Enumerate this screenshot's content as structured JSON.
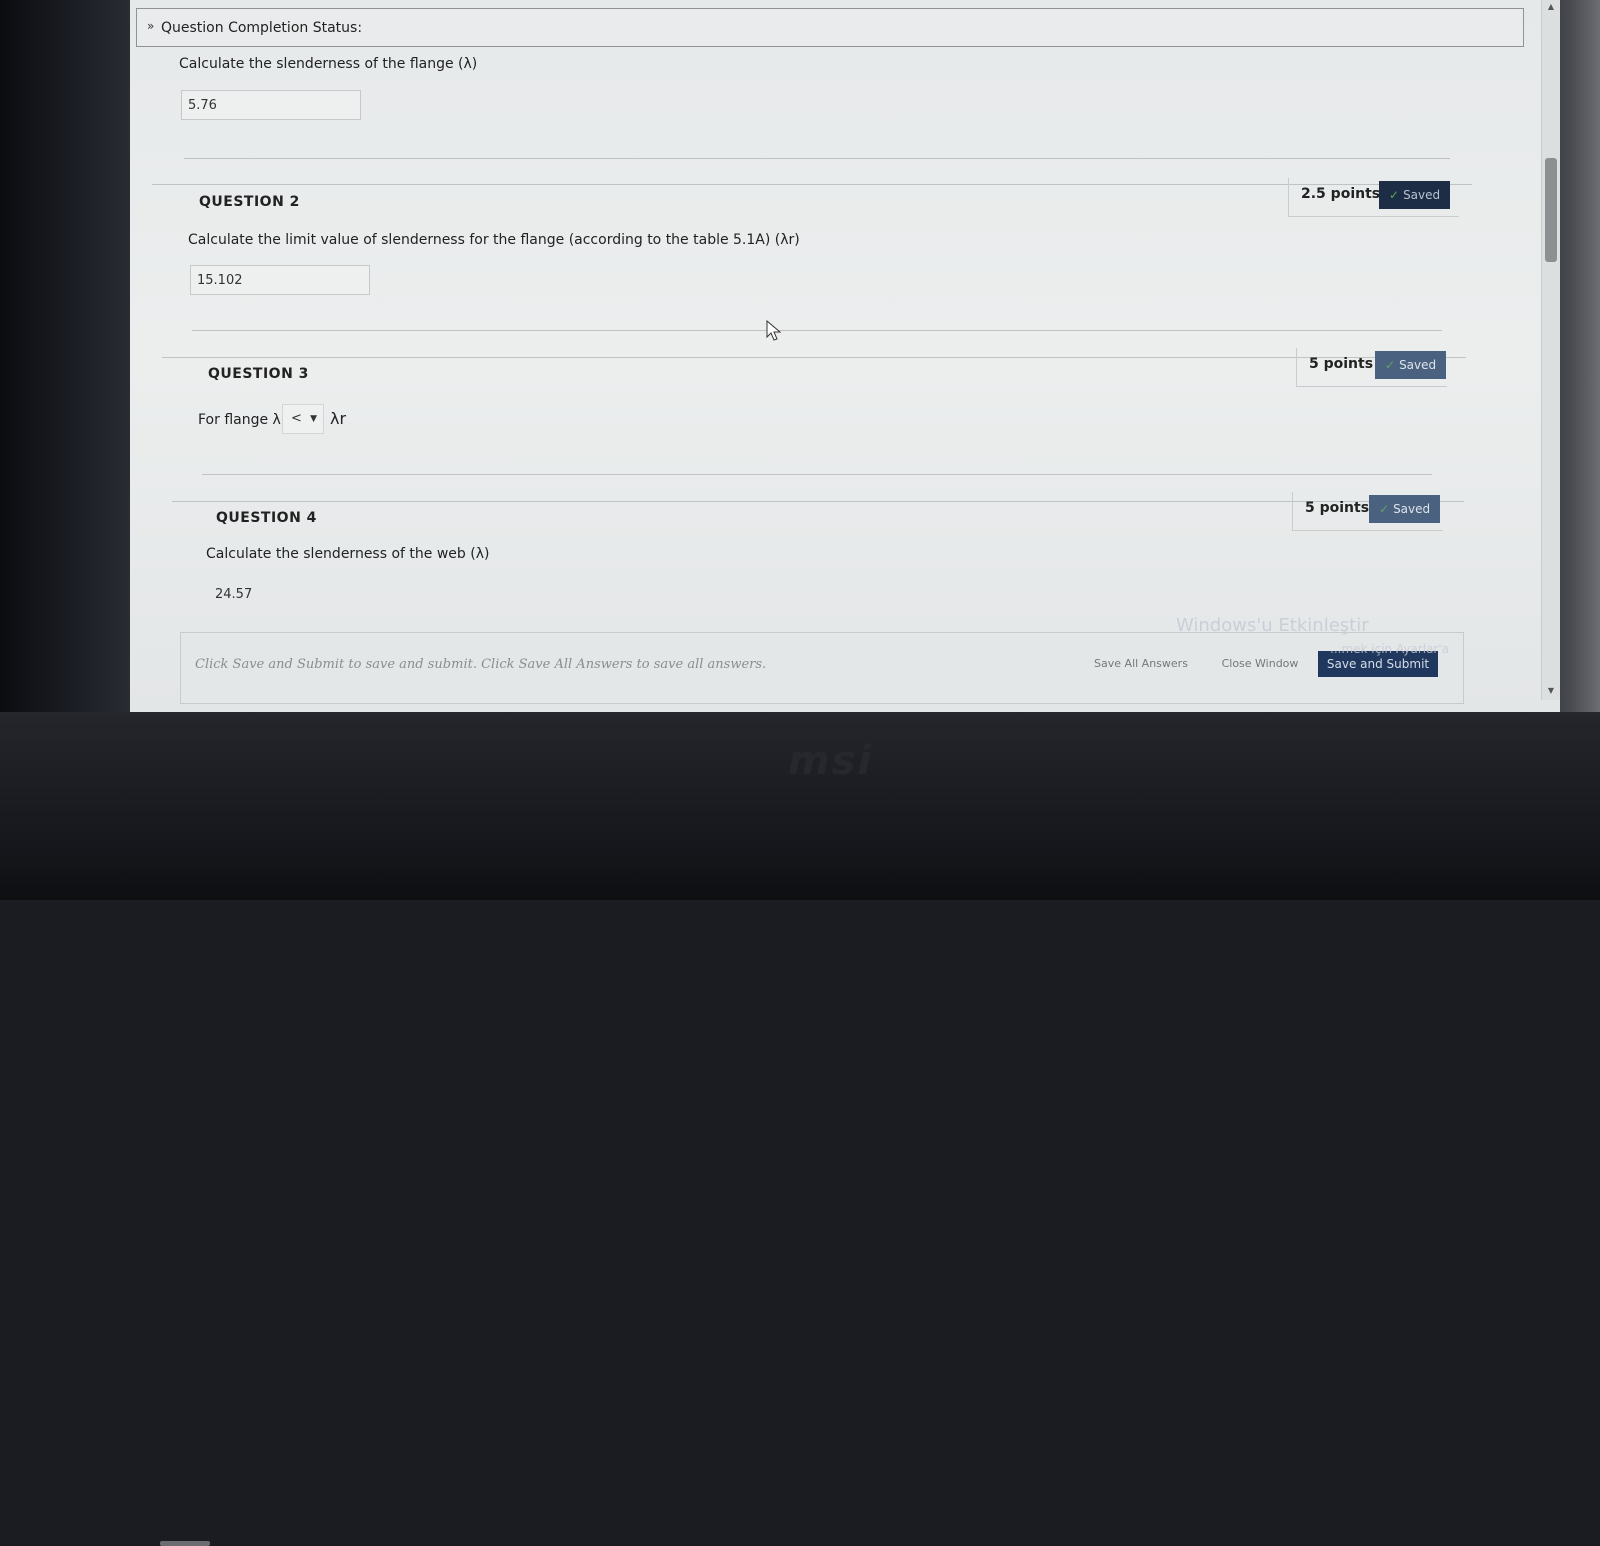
{
  "status_bar": {
    "label": "Question Completion Status:"
  },
  "question1": {
    "prompt": "Calculate the slenderness of the flange (λ)",
    "answer": "5.76"
  },
  "question2": {
    "title": "QUESTION 2",
    "points": "2.5 points",
    "saved": "Saved",
    "prompt": "Calculate the limit value of slenderness for the flange (according to the table 5.1A) (λr)",
    "answer": "15.102"
  },
  "question3": {
    "title": "QUESTION 3",
    "points": "5 points",
    "saved": "Saved",
    "prompt_left": "For flange λ",
    "select_value": "<",
    "prompt_right": "λr"
  },
  "question4": {
    "title": "QUESTION 4",
    "points": "5 points",
    "saved": "Saved",
    "prompt": "Calculate the slenderness of the web (λ)",
    "answer": "24.57"
  },
  "footer": {
    "note": "Click Save and Submit to save and submit. Click Save All Answers to save all answers.",
    "save_all": "Save All Answers",
    "close_window": "Close Window",
    "save_submit": "Save and Submit"
  },
  "watermark": {
    "title": "Windows'u Etkinleştir",
    "subtitle": "...mek için Ayarlar'a"
  },
  "colors": {
    "saved_badge": "#1d2d45",
    "primary_button": "#20385e",
    "check": "#5fa35f"
  }
}
